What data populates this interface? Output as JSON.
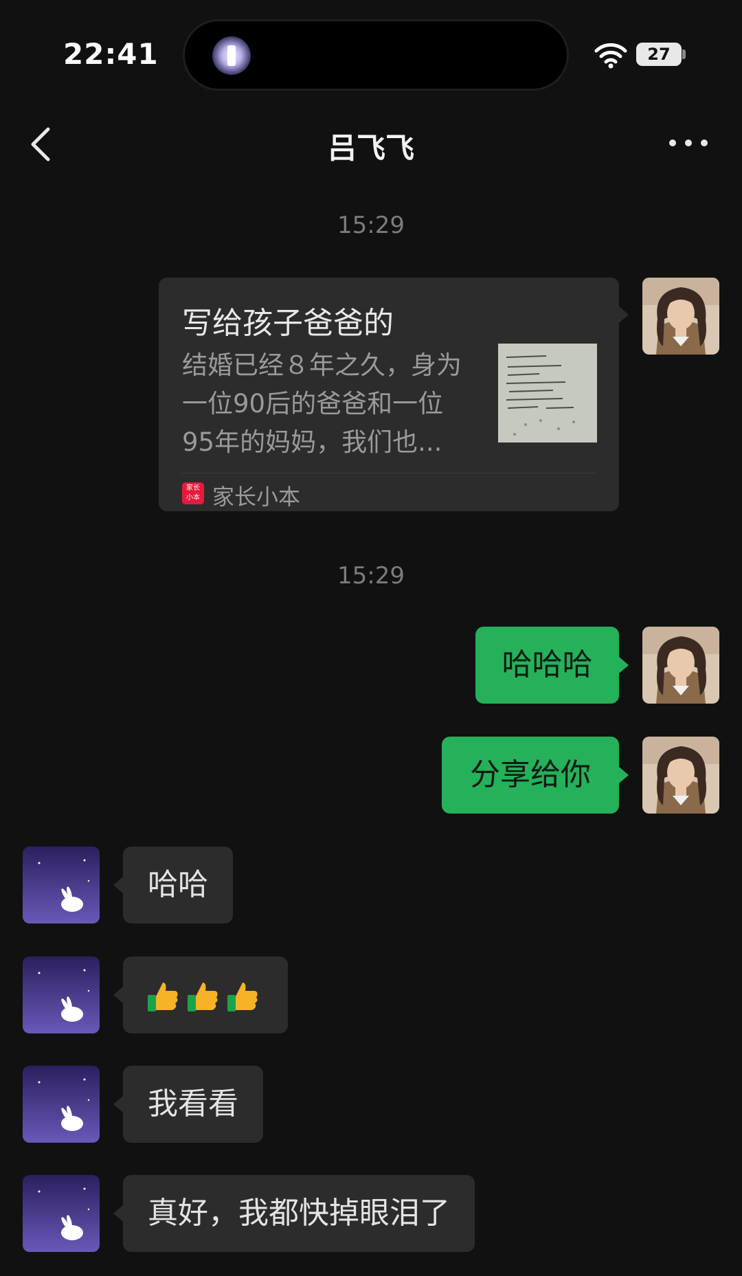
{
  "status_bar": {
    "time": "22:41",
    "battery": "27"
  },
  "nav": {
    "title": "吕飞飞"
  },
  "timestamps": [
    "15:29",
    "15:29"
  ],
  "shared_card": {
    "title": "写给孩子爸爸的",
    "description_lines": [
      "结婚已经８年之久，身为",
      "一位90后的爸爸和一位",
      "95年的妈妈，我们也..."
    ],
    "source_icon_text": "家长小本",
    "source": "家长小本"
  },
  "messages": [
    {
      "side": "right",
      "text": "哈哈哈"
    },
    {
      "side": "right",
      "text": "分享给你"
    },
    {
      "side": "left",
      "text": "哈哈"
    },
    {
      "side": "left",
      "emoji": [
        "thumbs-up-icon",
        "thumbs-up-icon",
        "thumbs-up-icon"
      ]
    },
    {
      "side": "left",
      "text": "我看看"
    },
    {
      "side": "left",
      "text": "真好，我都快掉眼泪了"
    }
  ],
  "colors": {
    "background": "#111111",
    "bubble_sent": "#24b15a",
    "bubble_received": "#2c2c2c",
    "source_icon": "#e8193c"
  }
}
